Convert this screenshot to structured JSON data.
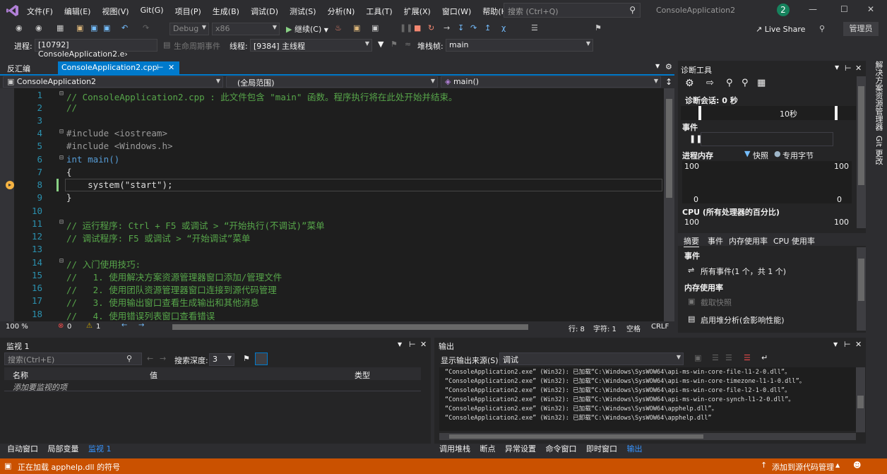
{
  "menubar": {
    "items": [
      "文件(F)",
      "编辑(E)",
      "视图(V)",
      "Git(G)",
      "项目(P)",
      "生成(B)",
      "调试(D)",
      "测试(S)",
      "分析(N)",
      "工具(T)",
      "扩展(X)",
      "窗口(W)",
      "帮助(H)"
    ],
    "search_placeholder": "搜索 (Ctrl+Q)",
    "solution_title": "ConsoleApplication2",
    "live_count": "2"
  },
  "toolbar": {
    "config": "Debug",
    "platform": "x86",
    "continue_label": "继续(C)",
    "live_share": "Live Share",
    "admin": "管理员",
    "process_label": "进程:",
    "process_value": "[10792] ConsoleApplication2.e›",
    "lifecycle_label": "生命周期事件",
    "thread_label": "线程:",
    "thread_value": "[9384] 主线程",
    "stackframe_label": "堆栈帧:",
    "stackframe_value": "main"
  },
  "editor": {
    "tab_disasm": "反汇编",
    "tab_active": "ConsoleApplication2.cpp",
    "nav_project": "ConsoleApplication2",
    "nav_scope": "(全局范围)",
    "nav_member": "main()",
    "lines": [
      {
        "n": "1",
        "t": "// ConsoleApplication2.cpp : 此文件包含 \"main\" 函数。程序执行将在此处开始并结束。"
      },
      {
        "n": "2",
        "t": "//"
      },
      {
        "n": "3",
        "t": ""
      },
      {
        "n": "4",
        "t": "#include <iostream>"
      },
      {
        "n": "5",
        "t": "#include <Windows.h>"
      },
      {
        "n": "6",
        "t": "int main()"
      },
      {
        "n": "7",
        "t": "{"
      },
      {
        "n": "8",
        "t": "    system(\"start\");"
      },
      {
        "n": "9",
        "t": "}"
      },
      {
        "n": "10",
        "t": ""
      },
      {
        "n": "11",
        "t": "// 运行程序: Ctrl + F5 或调试 > “开始执行(不调试)”菜单"
      },
      {
        "n": "12",
        "t": "// 调试程序: F5 或调试 > “开始调试”菜单"
      },
      {
        "n": "13",
        "t": ""
      },
      {
        "n": "14",
        "t": "// 入门使用技巧: "
      },
      {
        "n": "15",
        "t": "//   1. 使用解决方案资源管理器窗口添加/管理文件"
      },
      {
        "n": "16",
        "t": "//   2. 使用团队资源管理器窗口连接到源代码管理"
      },
      {
        "n": "17",
        "t": "//   3. 使用输出窗口查看生成输出和其他消息"
      },
      {
        "n": "18",
        "t": "//   4. 使用错误列表窗口查看错误"
      }
    ],
    "zoom": "100 %",
    "errors": "0",
    "warnings": "1",
    "row": "行: 8",
    "col": "字符: 1",
    "ws": "空格",
    "eol": "CRLF"
  },
  "diag": {
    "title": "诊断工具",
    "session": "诊断会话: 0 秒",
    "tick": "10秒",
    "events": "事件",
    "memory": "进程内存",
    "snapshot": "快照",
    "private_bytes": "专用字节",
    "mem_top": "100",
    "mem_bottom": "0",
    "cpu": "CPU (所有处理器的百分比)",
    "cpu_top": "100",
    "tabs": [
      "摘要",
      "事件",
      "内存使用率",
      "CPU 使用率"
    ],
    "section_events": "事件",
    "all_events": "所有事件(1 个，共 1 个)",
    "section_mem": "内存使用率",
    "take_snapshot": "截取快照",
    "heap": "启用堆分析(会影响性能)"
  },
  "sidebar": {
    "solution_explorer": "解决方案资源管理器",
    "git": "Git 更改"
  },
  "watch": {
    "title": "监视 1",
    "search_placeholder": "搜索(Ctrl+E)",
    "depth_label": "搜索深度:",
    "depth": "3",
    "col_name": "名称",
    "col_value": "值",
    "col_type": "类型",
    "add_item": "添加要监视的项",
    "tabs": [
      "自动窗口",
      "局部变量",
      "监视 1"
    ]
  },
  "output": {
    "title": "输出",
    "source_label": "显示输出来源(S):",
    "source": "调试",
    "lines": [
      "“ConsoleApplication2.exe” (Win32): 已加载“C:\\Windows\\SysWOW64\\api-ms-win-core-file-l1-2-0.dll”。",
      "“ConsoleApplication2.exe” (Win32): 已加载“C:\\Windows\\SysWOW64\\api-ms-win-core-timezone-l1-1-0.dll”。",
      "“ConsoleApplication2.exe” (Win32): 已加载“C:\\Windows\\SysWOW64\\api-ms-win-core-file-l2-1-0.dll”。",
      "“ConsoleApplication2.exe” (Win32): 已加载“C:\\Windows\\SysWOW64\\api-ms-win-core-synch-l1-2-0.dll”。",
      "“ConsoleApplication2.exe” (Win32): 已加载“C:\\Windows\\SysWOW64\\apphelp.dll”。",
      "“ConsoleApplication2.exe” (Win32): 已卸载“C:\\Windows\\SysWOW64\\apphelp.dll”"
    ],
    "tabs": [
      "调用堆栈",
      "断点",
      "异常设置",
      "命令窗口",
      "即时窗口",
      "输出"
    ]
  },
  "status": {
    "loading": "正在加载 apphelp.dll 的符号",
    "source_control": "添加到源代码管理"
  }
}
